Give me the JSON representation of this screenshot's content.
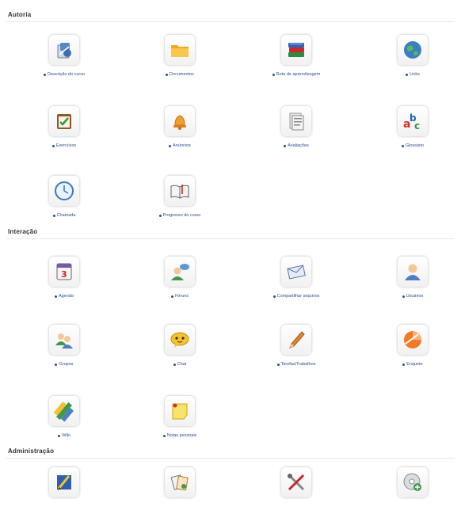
{
  "sections": {
    "autoria": {
      "title": "Autoria",
      "tools": [
        {
          "label": "Descrição do curso",
          "icon": "course-description-icon"
        },
        {
          "label": "Documentos",
          "icon": "folder-icon"
        },
        {
          "label": "Rota de aprendizagem",
          "icon": "books-icon"
        },
        {
          "label": "Links",
          "icon": "globe-icon"
        },
        {
          "label": "Exercícios",
          "icon": "clipboard-check-icon"
        },
        {
          "label": "Anúncios",
          "icon": "bell-icon"
        },
        {
          "label": "Avaliações",
          "icon": "document-icon"
        },
        {
          "label": "Glossário",
          "icon": "abc-letters-icon"
        },
        {
          "label": "Chamada",
          "icon": "clock-icon"
        },
        {
          "label": "Progresso do curso",
          "icon": "open-book-icon"
        }
      ]
    },
    "interacao": {
      "title": "Interação",
      "tools": [
        {
          "label": "Agenda",
          "icon": "calendar-icon"
        },
        {
          "label": "Fóruns",
          "icon": "forum-users-icon"
        },
        {
          "label": "Compartilhar arquivos",
          "icon": "envelope-icon"
        },
        {
          "label": "Usuários",
          "icon": "user-icon"
        },
        {
          "label": "Grupos",
          "icon": "group-icon"
        },
        {
          "label": "Chat",
          "icon": "chat-icon"
        },
        {
          "label": "Tarefas/Trabalhos",
          "icon": "pencil-icon"
        },
        {
          "label": "Enquete",
          "icon": "survey-icon"
        },
        {
          "label": "Wiki",
          "icon": "wiki-colors-icon"
        },
        {
          "label": "Notas pessoais",
          "icon": "sticky-note-icon"
        }
      ]
    },
    "administracao": {
      "title": "Administração",
      "tools": [
        {
          "icon": "settings-pen-icon"
        },
        {
          "icon": "cards-icon"
        },
        {
          "icon": "tools-icon"
        },
        {
          "icon": "disc-add-icon"
        }
      ]
    }
  }
}
